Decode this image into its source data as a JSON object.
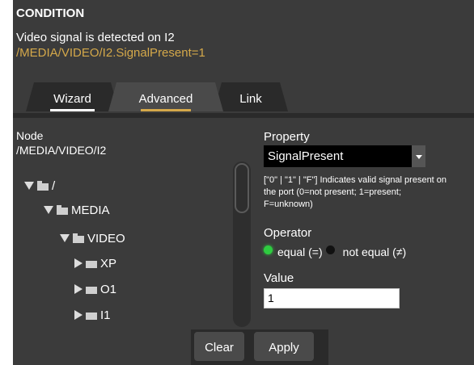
{
  "condition": {
    "title": "CONDITION",
    "description": "Video signal is detected on I2",
    "expression": "/MEDIA/VIDEO/I2.SignalPresent=1"
  },
  "tabs": [
    {
      "label": "Wizard"
    },
    {
      "label": "Advanced",
      "active": true
    },
    {
      "label": "Link"
    }
  ],
  "node": {
    "label": "Node",
    "path": "/MEDIA/VIDEO/I2",
    "tree": [
      {
        "label": "/",
        "expanded": true
      },
      {
        "label": "MEDIA",
        "expanded": true
      },
      {
        "label": "VIDEO",
        "expanded": true
      },
      {
        "label": "XP",
        "expanded": false
      },
      {
        "label": "O1",
        "expanded": false
      },
      {
        "label": "I1",
        "expanded": false
      }
    ]
  },
  "property": {
    "label": "Property",
    "selected": "SignalPresent",
    "help_line1": "[\"0\" | \"1\" | \"F\"] Indicates valid signal present on",
    "help_line2": "the port (0=not present; 1=present;",
    "help_line3": "F=unknown)"
  },
  "operator": {
    "label": "Operator",
    "options": [
      {
        "label": "equal (=)",
        "selected": true
      },
      {
        "label": "not equal (≠)",
        "selected": false
      }
    ]
  },
  "value": {
    "label": "Value",
    "current": "1"
  },
  "buttons": {
    "clear": "Clear",
    "apply": "Apply"
  },
  "colors": {
    "panel_bg": "#3b3b3b",
    "accent": "#d4a84a",
    "radio_on": "#2ecc40"
  }
}
